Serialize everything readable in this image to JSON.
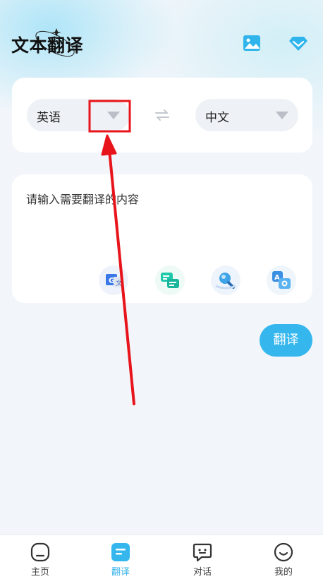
{
  "header": {
    "title": "文本翻译",
    "image_button_icon": "image-icon",
    "vip_button_icon": "diamond-icon"
  },
  "languages": {
    "source": "英语",
    "target": "中文",
    "swap_icon": "swap-arrows-icon",
    "dropdown_icon": "triangle-down-icon"
  },
  "input": {
    "placeholder": "请输入需要翻译的内容",
    "tools": [
      {
        "icon": "google-translate-icon"
      },
      {
        "icon": "document-translate-icon"
      },
      {
        "icon": "magnifier-search-icon"
      },
      {
        "icon": "camera-translate-icon"
      }
    ]
  },
  "translate_button": "翻译",
  "bottom_nav": {
    "items": [
      {
        "label": "主页",
        "icon": "home-icon",
        "active": false
      },
      {
        "label": "翻译",
        "icon": "translate-doc-icon",
        "active": true
      },
      {
        "label": "对话",
        "icon": "chat-icon",
        "active": false
      },
      {
        "label": "我的",
        "icon": "profile-icon",
        "active": false
      }
    ]
  },
  "colors": {
    "accent": "#35b7ee",
    "page_bg": "#f2f6fa",
    "annotation_red": "#e8141b"
  }
}
